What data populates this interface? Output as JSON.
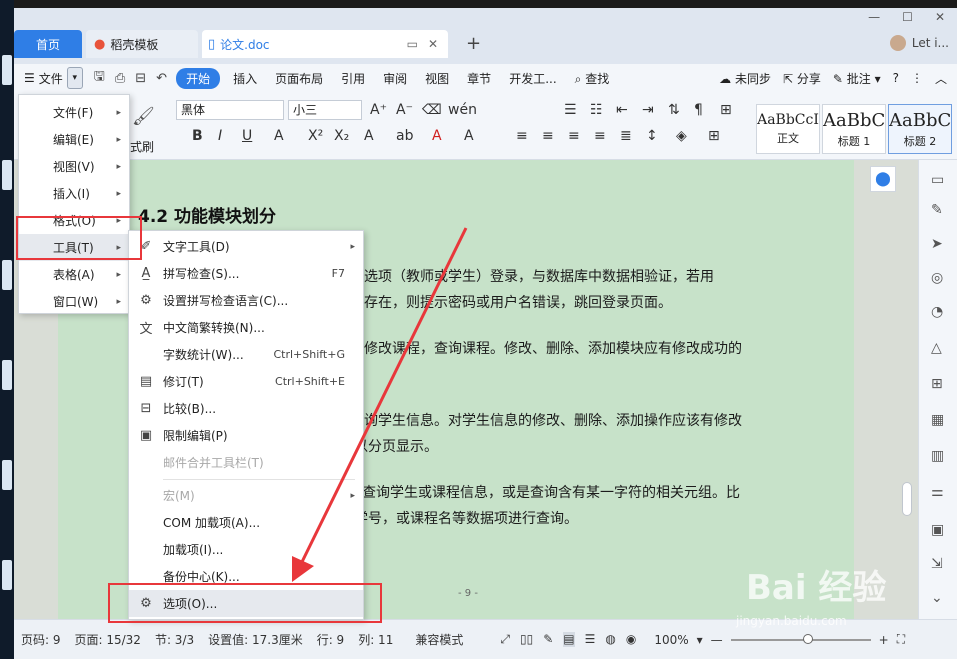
{
  "tabs": {
    "home": "首页",
    "daoke": "稻壳模板",
    "doc": "论文.doc"
  },
  "account": "Let i...",
  "menubar": {
    "file": "文件",
    "items": [
      "开始",
      "插入",
      "页面布局",
      "引用",
      "审阅",
      "视图",
      "章节",
      "开发工..."
    ],
    "search": "查找",
    "sync": "未同步",
    "share": "分享",
    "comment": "批注"
  },
  "ribbon": {
    "font": "黑体",
    "size": "小三",
    "style_cards": [
      {
        "sample": "AaBbCcI",
        "name": "正文"
      },
      {
        "sample": "AaBbC",
        "name": "标题 1"
      },
      {
        "sample": "AaBbCc",
        "name": "标题 2"
      }
    ],
    "format_painter": "式刷"
  },
  "document": {
    "heading": "4.2  功能模块划分",
    "paragraphs": [
      "的登录选项（教师或学生）登录，与数据库中数据相验证，若用",
      "用户不存在，则提示密码或用户名错误，跳回登录页面。",
      "、修改课程，查询课程。修改、删除、添加模块应有修改成功的",
      "。",
      "查询学生信息。对学生信息的修改、删除、添加操作应该有修改",
      "以分页显示。",
      "项查询学生或课程信息，或是查询含有某一字符的相关元组。比",
      "学号，或课程名等数据项进行查询。"
    ],
    "page_footer": "- 9 -"
  },
  "menu_main": [
    {
      "label": "文件(F)",
      "submenu": true
    },
    {
      "label": "编辑(E)",
      "submenu": true
    },
    {
      "label": "视图(V)",
      "submenu": true
    },
    {
      "label": "插入(I)",
      "submenu": true
    },
    {
      "label": "格式(O)",
      "submenu": true
    },
    {
      "label": "工具(T)",
      "submenu": true
    },
    {
      "label": "表格(A)",
      "submenu": true
    },
    {
      "label": "窗口(W)",
      "submenu": true
    }
  ],
  "menu_tools": [
    {
      "label": "文字工具(D)",
      "shortcut": "",
      "icon": "text-tool-icon",
      "submenu": true,
      "disabled": false
    },
    {
      "label": "拼写检查(S)...",
      "shortcut": "F7",
      "icon": "spellcheck-icon",
      "submenu": false,
      "disabled": false
    },
    {
      "label": "设置拼写检查语言(C)...",
      "shortcut": "",
      "icon": "language-icon",
      "submenu": false,
      "disabled": false
    },
    {
      "label": "中文简繁转换(N)...",
      "shortcut": "",
      "icon": "convert-icon",
      "submenu": false,
      "disabled": false
    },
    {
      "label": "字数统计(W)...",
      "shortcut": "Ctrl+Shift+G",
      "icon": "",
      "submenu": false,
      "disabled": false
    },
    {
      "label": "修订(T)",
      "shortcut": "Ctrl+Shift+E",
      "icon": "revision-icon",
      "submenu": false,
      "disabled": false
    },
    {
      "label": "比较(B)...",
      "shortcut": "",
      "icon": "compare-icon",
      "submenu": false,
      "disabled": false
    },
    {
      "label": "限制编辑(P)",
      "shortcut": "",
      "icon": "restrict-icon",
      "submenu": false,
      "disabled": false
    },
    {
      "label": "邮件合并工具栏(T)",
      "shortcut": "",
      "icon": "",
      "submenu": false,
      "disabled": true
    },
    {
      "label": "宏(M)",
      "shortcut": "",
      "icon": "",
      "submenu": true,
      "disabled": true
    },
    {
      "label": "COM 加载项(A)...",
      "shortcut": "",
      "icon": "",
      "submenu": false,
      "disabled": false
    },
    {
      "label": "加载项(I)...",
      "shortcut": "",
      "icon": "",
      "submenu": false,
      "disabled": false
    },
    {
      "label": "备份中心(K)...",
      "shortcut": "",
      "icon": "",
      "submenu": false,
      "disabled": false
    },
    {
      "label": "选项(O)...",
      "shortcut": "",
      "icon": "gear-icon",
      "submenu": false,
      "disabled": false
    }
  ],
  "statusbar": {
    "page_no": "页码: 9",
    "pages": "页面: 15/32",
    "section": "节: 3/3",
    "setting": "设置值: 17.3厘米",
    "row": "行: 9",
    "col": "列: 11",
    "compat": "兼容模式",
    "zoom": "100%",
    "zoom_level": 0.55
  },
  "watermark": {
    "brand": "Bai 经验",
    "url": "jingyan.baidu.com"
  },
  "colors": {
    "accent": "#2f7ee6",
    "highlight_box": "#e8373b",
    "page_bg": "#c7e2c9"
  }
}
